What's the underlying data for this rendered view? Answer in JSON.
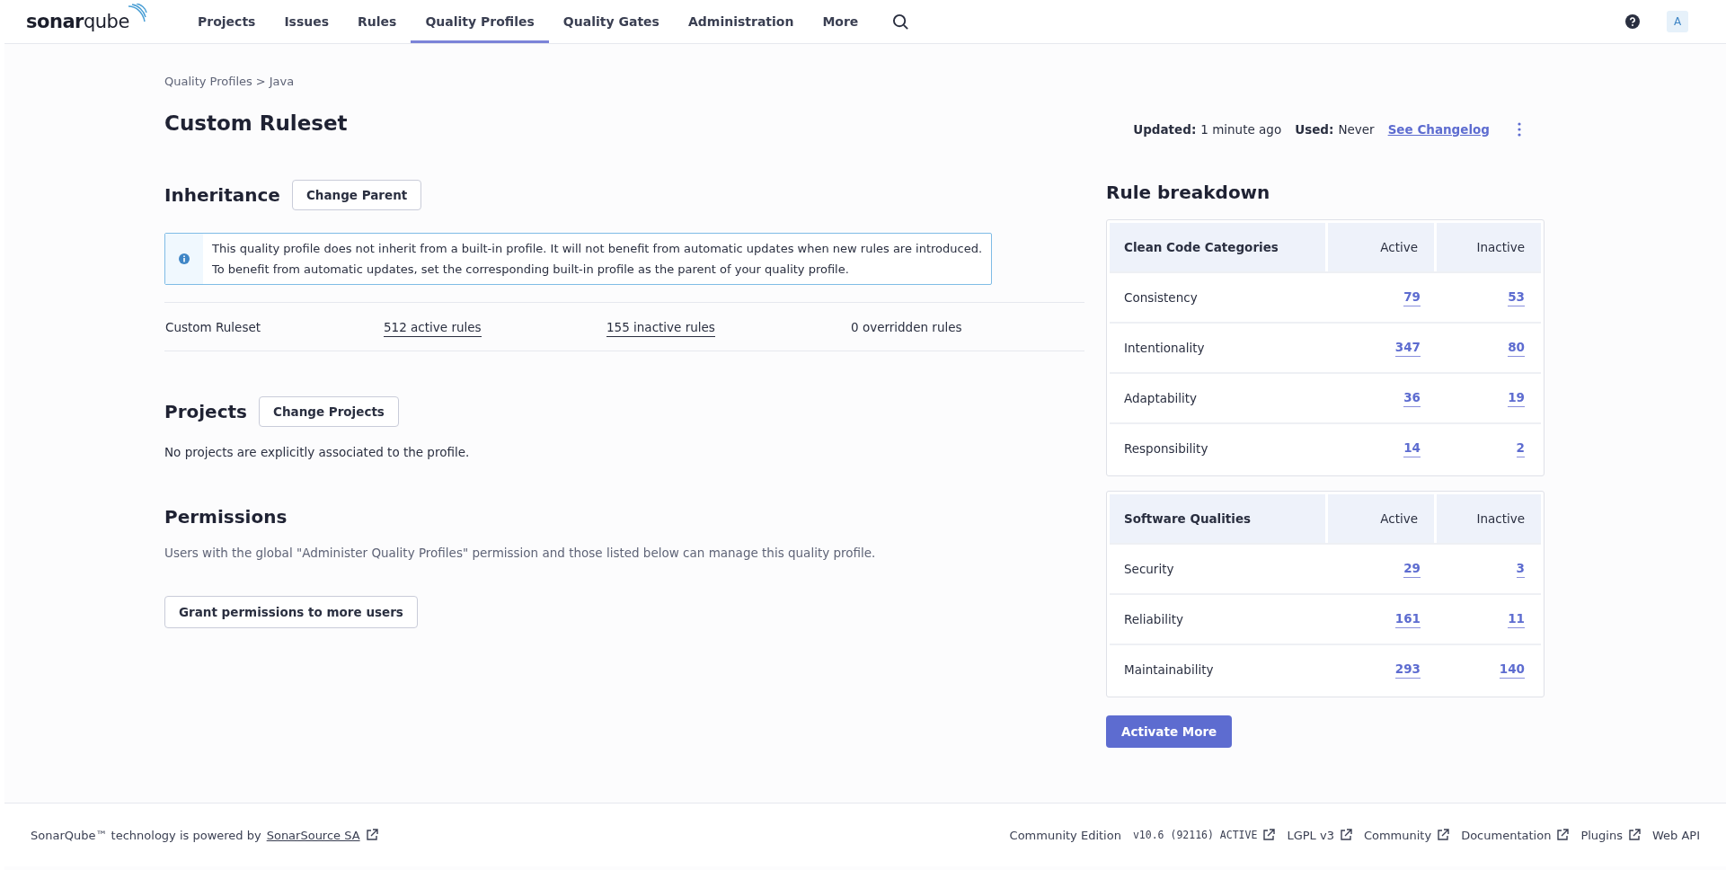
{
  "nav": {
    "logo": "**sonar**qube",
    "items": [
      {
        "label": "Projects",
        "selected": false
      },
      {
        "label": "Issues",
        "selected": false
      },
      {
        "label": "Rules",
        "selected": false
      },
      {
        "label": "Quality Profiles",
        "selected": true
      },
      {
        "label": "Quality Gates",
        "selected": false
      },
      {
        "label": "Administration",
        "selected": false
      },
      {
        "label": "More",
        "selected": false
      }
    ],
    "avatar": "A"
  },
  "breadcrumb": {
    "items": [
      "Quality Profiles",
      "Java"
    ],
    "separator": ">"
  },
  "title": "Custom Ruleset",
  "meta": {
    "updated_label": "Updated:",
    "updated_value": "1 minute ago",
    "used_label": "Used:",
    "used_value": "Never",
    "changelog": "See Changelog"
  },
  "inheritance": {
    "heading": "Inheritance",
    "button": "Change Parent",
    "info_lines": [
      "This quality profile does not inherit from a built-in profile. It will not benefit from automatic updates when new rules are introduced.",
      "To benefit from automatic updates, set the corresponding built-in profile as the parent of your quality profile."
    ],
    "row": {
      "name": "Custom Ruleset",
      "active": "512 active rules",
      "inactive": "155 inactive rules",
      "overridden": "0 overridden rules"
    }
  },
  "projects": {
    "heading": "Projects",
    "button": "Change Projects",
    "empty": "No projects are explicitly associated to the profile."
  },
  "permissions": {
    "heading": "Permissions",
    "description": "Users with the global \"Administer Quality Profiles\" permission and those listed below can manage this quality profile.",
    "button": "Grant permissions to more users"
  },
  "breakdown": {
    "title": "Rule breakdown",
    "tables": [
      {
        "columns": [
          "Clean Code Categories",
          "Active",
          "Inactive"
        ],
        "rows": [
          {
            "label": "Consistency",
            "active": "79",
            "inactive": "53"
          },
          {
            "label": "Intentionality",
            "active": "347",
            "inactive": "80"
          },
          {
            "label": "Adaptability",
            "active": "36",
            "inactive": "19"
          },
          {
            "label": "Responsibility",
            "active": "14",
            "inactive": "2"
          }
        ]
      },
      {
        "columns": [
          "Software Qualities",
          "Active",
          "Inactive"
        ],
        "rows": [
          {
            "label": "Security",
            "active": "29",
            "inactive": "3"
          },
          {
            "label": "Reliability",
            "active": "161",
            "inactive": "11"
          },
          {
            "label": "Maintainability",
            "active": "293",
            "inactive": "140"
          }
        ]
      }
    ],
    "button": "Activate More"
  },
  "footer": {
    "text": "SonarQube™ technology is powered by",
    "link": "SonarSource SA",
    "items": [
      {
        "kind": "text",
        "label": "Community Edition",
        "external": false
      },
      {
        "kind": "version",
        "label": "v10.6 (92116) ACTIVE",
        "external": true
      },
      {
        "kind": "link",
        "label": "LGPL v3",
        "external": true
      },
      {
        "kind": "link",
        "label": "Community",
        "external": true
      },
      {
        "kind": "link",
        "label": "Documentation",
        "external": true
      },
      {
        "kind": "link",
        "label": "Plugins",
        "external": true
      },
      {
        "kind": "link",
        "label": "Web API",
        "external": false
      }
    ]
  }
}
